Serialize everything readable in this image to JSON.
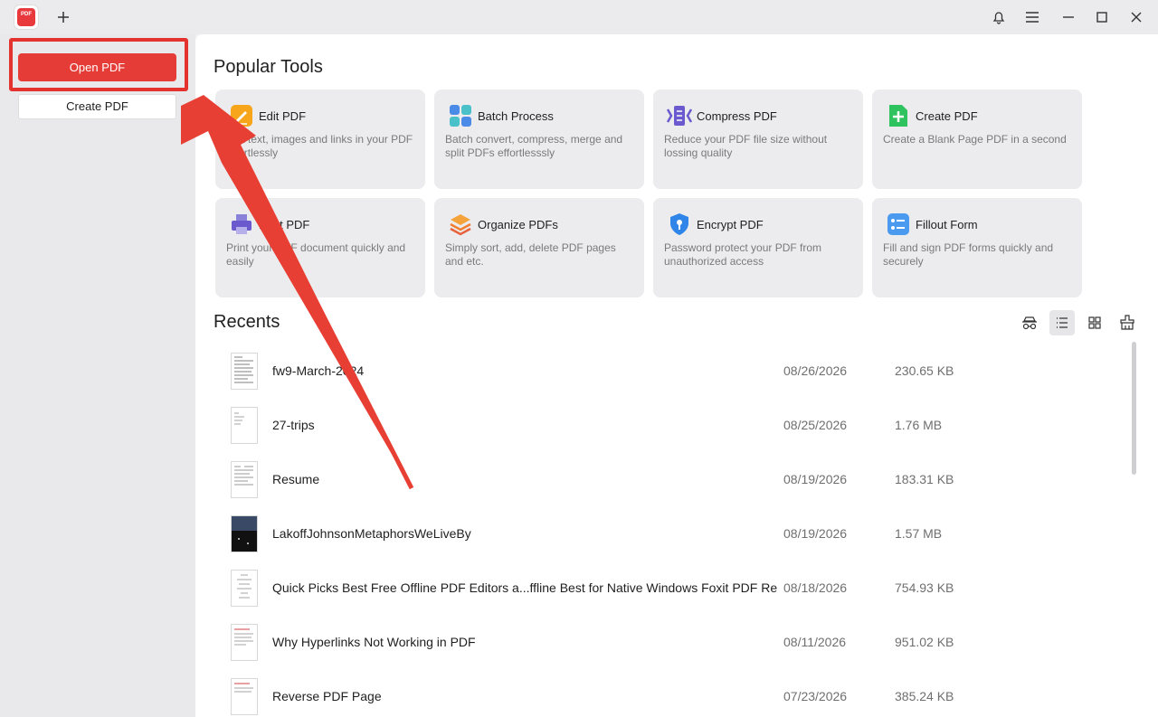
{
  "titlebar": {
    "logo_text": "PDF",
    "icons": [
      "app-logo-icon",
      "plus-icon",
      "bell-icon",
      "menu-icon",
      "minimize-icon",
      "maximize-icon",
      "close-icon"
    ]
  },
  "sidebar": {
    "open_label": "Open PDF",
    "create_label": "Create PDF"
  },
  "popular_tools": {
    "title": "Popular Tools",
    "tools": [
      {
        "name": "Edit PDF",
        "desc": "Edit text, images and links in your PDF effortlessly",
        "icon": "edit-icon"
      },
      {
        "name": "Batch Process",
        "desc": "Batch convert, compress, merge and split PDFs effortlesssly",
        "icon": "batch-icon"
      },
      {
        "name": "Compress PDF",
        "desc": "Reduce your PDF file size without lossing quality",
        "icon": "compress-icon"
      },
      {
        "name": "Create PDF",
        "desc": "Create a Blank Page PDF in a second",
        "icon": "create-icon"
      },
      {
        "name": "Print PDF",
        "desc": "Print your PDF document quickly and easily",
        "icon": "print-icon"
      },
      {
        "name": "Organize PDFs",
        "desc": "Simply sort, add, delete PDF pages and etc.",
        "icon": "organize-icon"
      },
      {
        "name": "Encrypt PDF",
        "desc": "Password protect your PDF from unauthorized access",
        "icon": "encrypt-icon"
      },
      {
        "name": "Fillout Form",
        "desc": "Fill and sign PDF forms quickly and securely",
        "icon": "form-icon"
      }
    ]
  },
  "recents": {
    "title": "Recents",
    "view_icons": [
      "incognito-icon",
      "list-view-icon",
      "grid-view-icon",
      "clear-icon"
    ],
    "files": [
      {
        "name": "fw9-March-2024",
        "date": "08/26/2026",
        "size": "230.65 KB"
      },
      {
        "name": "27-trips",
        "date": "08/25/2026",
        "size": "1.76 MB"
      },
      {
        "name": "Resume",
        "date": "08/19/2026",
        "size": "183.31 KB"
      },
      {
        "name": "LakoffJohnsonMetaphorsWeLiveBy",
        "date": "08/19/2026",
        "size": "1.57 MB"
      },
      {
        "name": "Quick Picks Best Free Offline PDF Editors a...ffline Best for Native Windows Foxit PDF Re",
        "date": "08/18/2026",
        "size": "754.93 KB"
      },
      {
        "name": "Why Hyperlinks Not Working in PDF",
        "date": "08/11/2026",
        "size": "951.02 KB"
      },
      {
        "name": "Reverse PDF Page",
        "date": "07/23/2026",
        "size": "385.24 KB"
      }
    ]
  },
  "colors": {
    "accent": "#e63c37",
    "annotation_red": "#e4332e"
  }
}
